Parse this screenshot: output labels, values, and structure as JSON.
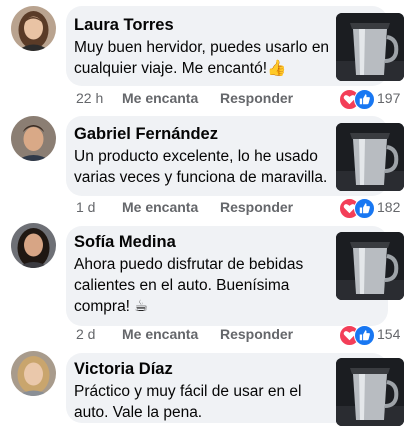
{
  "comments": [
    {
      "name": "Laura Torres",
      "text": "Muy buen hervidor, puedes usarlo en cualquier viaje. Me encantó!👍",
      "time": "22 h",
      "like_label": "Me encanta",
      "reply_label": "Responder",
      "reaction_count": "197"
    },
    {
      "name": "Gabriel Fernández",
      "text": "Un producto excelente, lo he usado varias veces y funciona de maravilla.",
      "time": "1 d",
      "like_label": "Me encanta",
      "reply_label": "Responder",
      "reaction_count": "182"
    },
    {
      "name": "Sofía Medina",
      "text": "Ahora puedo disfrutar de bebidas calientes en el auto. Buenísima compra! ☕",
      "time": "2 d",
      "like_label": "Me encanta",
      "reply_label": "Responder",
      "reaction_count": "154"
    },
    {
      "name": "Victoria Díaz",
      "text": "Práctico y muy fácil de usar en el auto. Vale la pena.",
      "time": "",
      "like_label": "",
      "reply_label": "",
      "reaction_count": ""
    }
  ],
  "colors": {
    "bubble": "#f0f2f5",
    "love": "#f33e58",
    "like": "#1877f2",
    "meta_text": "#65676b"
  }
}
